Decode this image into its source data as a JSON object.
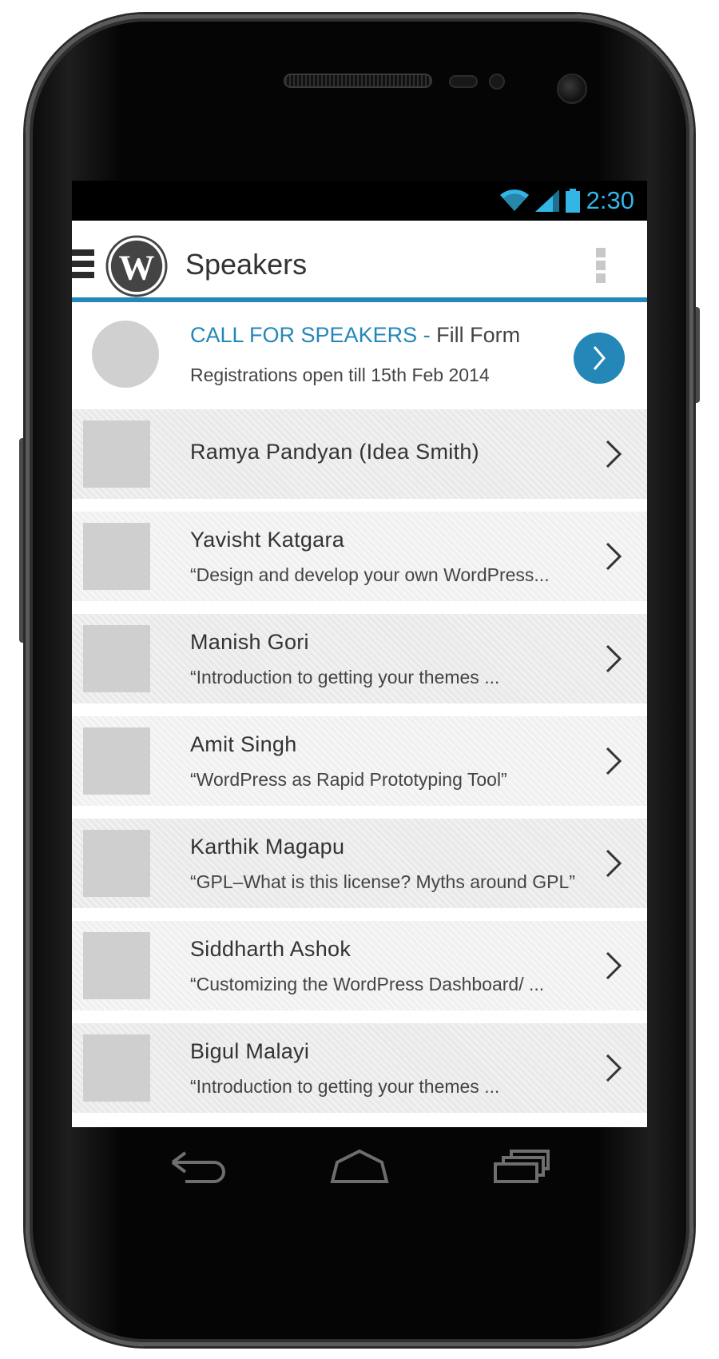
{
  "status_bar": {
    "time": "2:30",
    "icons": [
      "wifi-icon",
      "signal-icon",
      "battery-icon"
    ],
    "accent_color": "#33b5e5"
  },
  "action_bar": {
    "title": "Speakers",
    "icons": [
      "menu-icon",
      "wordpress-logo",
      "overflow-menu-icon"
    ],
    "accent_color": "#2487b8"
  },
  "call_for_speakers": {
    "title": "CALL FOR SPEAKERS - ",
    "action": "Fill Form",
    "subtitle": "Registrations open till 15th Feb 2014",
    "button_icon": "chevron-right-icon"
  },
  "speakers": [
    {
      "name": "Ramya Pandyan (Idea Smith)",
      "talk": ""
    },
    {
      "name": "Yavisht Katgara",
      "talk": "“Design and develop your own WordPress..."
    },
    {
      "name": "Manish Gori",
      "talk": " “Introduction to getting your themes ..."
    },
    {
      "name": "Amit Singh",
      "talk": "“WordPress as Rapid Prototyping Tool”"
    },
    {
      "name": "Karthik Magapu",
      "talk": "“GPL–What is this license? Myths around GPL”"
    },
    {
      "name": "Siddharth Ashok",
      "talk": "“Customizing the WordPress Dashboard/ ..."
    },
    {
      "name": "Bigul Malayi",
      "talk": " “Introduction to getting your themes ..."
    }
  ],
  "nav_bar": {
    "icons": [
      "back-icon",
      "home-icon",
      "recent-apps-icon"
    ]
  }
}
